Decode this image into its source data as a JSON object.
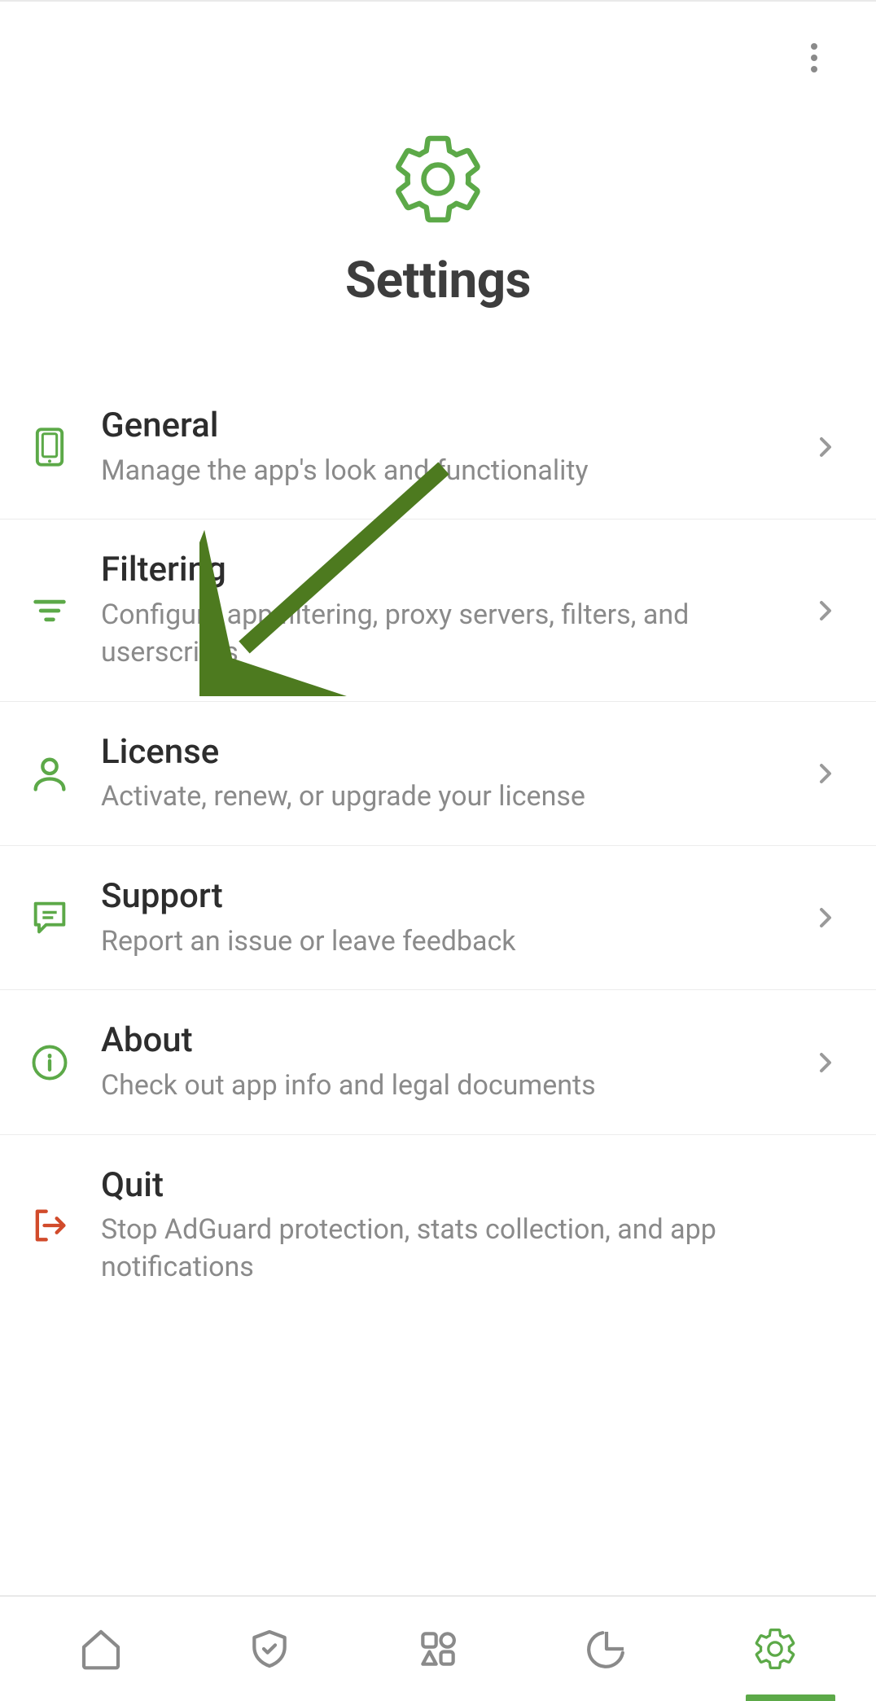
{
  "page": {
    "title": "Settings"
  },
  "items": [
    {
      "title": "General",
      "sub": "Manage the app's look and functionality"
    },
    {
      "title": "Filtering",
      "sub": "Configure app filtering, proxy servers, filters, and userscripts"
    },
    {
      "title": "License",
      "sub": "Activate, renew, or upgrade your license"
    },
    {
      "title": "Support",
      "sub": "Report an issue or leave feedback"
    },
    {
      "title": "About",
      "sub": "Check out app info and legal documents"
    },
    {
      "title": "Quit",
      "sub": "Stop AdGuard protection, stats collection, and app notifications"
    }
  ],
  "colors": {
    "accent": "#5ca948",
    "danger": "#d14b2b",
    "icon_muted": "#8a8a8a"
  }
}
